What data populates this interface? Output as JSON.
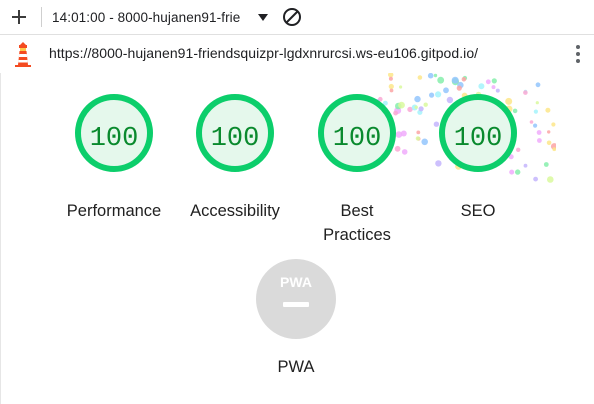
{
  "toolbar": {
    "new_report_label": "+",
    "report_selector": "14:01:00 - 8000-hujanen91-frie",
    "clear_icon": "block-icon"
  },
  "urlbar": {
    "url": "https://8000-hujanen91-friendsquizpr-lgdxnrurcsi.ws-eu106.gitpod.io/",
    "logo_icon": "lighthouse-icon",
    "menu_icon": "kebab-menu-icon"
  },
  "gauges": [
    {
      "title": "Performance",
      "score": "100",
      "value": 1.0
    },
    {
      "title": "Accessibility",
      "score": "100",
      "value": 1.0
    },
    {
      "title": "Best Practices",
      "score": "100",
      "value": 1.0
    },
    {
      "title": "SEO",
      "score": "100",
      "value": 1.0
    }
  ],
  "pwa": {
    "title": "PWA",
    "badge": "PWA"
  },
  "colors": {
    "pass_ring": "#0cce6b",
    "pass_fill": "#e5f8ec",
    "pass_text": "#0a8a2e",
    "pwa_gray": "#dadada"
  }
}
